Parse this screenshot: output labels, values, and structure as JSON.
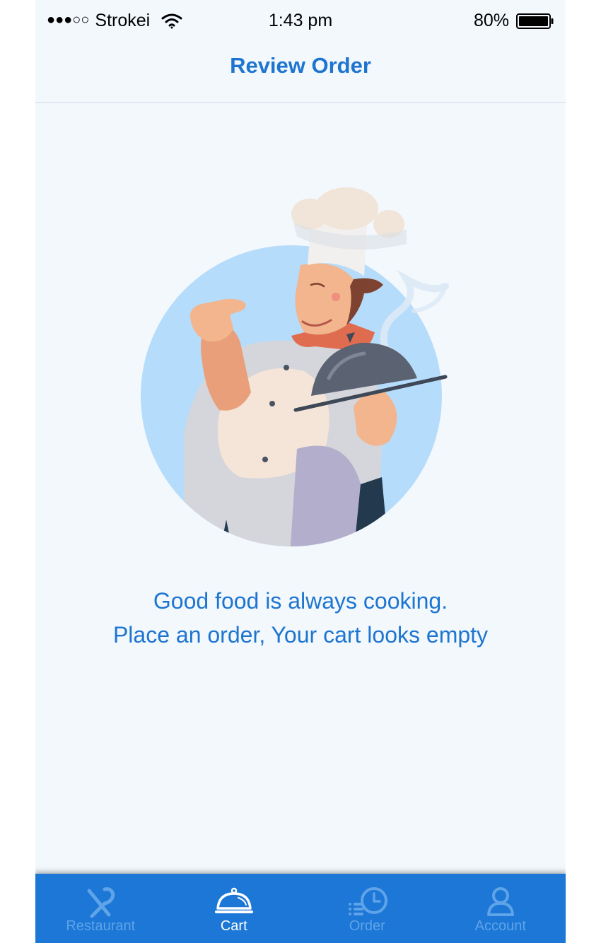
{
  "status_bar": {
    "signal": "●●●○○",
    "carrier": "Strokei",
    "time": "1:43 pm",
    "battery": "80%"
  },
  "header": {
    "title": "Review Order"
  },
  "empty_state": {
    "line1": "Good food is always cooking.",
    "line2": "Place an order, Your cart looks empty"
  },
  "tab_bar": {
    "tabs": [
      {
        "label": "Restaurant",
        "icon": "fork-knife-icon",
        "active": false
      },
      {
        "label": "Cart",
        "icon": "cloche-icon",
        "active": true
      },
      {
        "label": "Order",
        "icon": "order-history-icon",
        "active": false
      },
      {
        "label": "Account",
        "icon": "user-icon",
        "active": false
      }
    ]
  },
  "colors": {
    "accent": "#1d75d0",
    "tab_bar_bg": "#1c77d6",
    "tab_inactive": "#5fa3e8",
    "tab_active": "#ffffff",
    "background": "#f3f8fd"
  }
}
